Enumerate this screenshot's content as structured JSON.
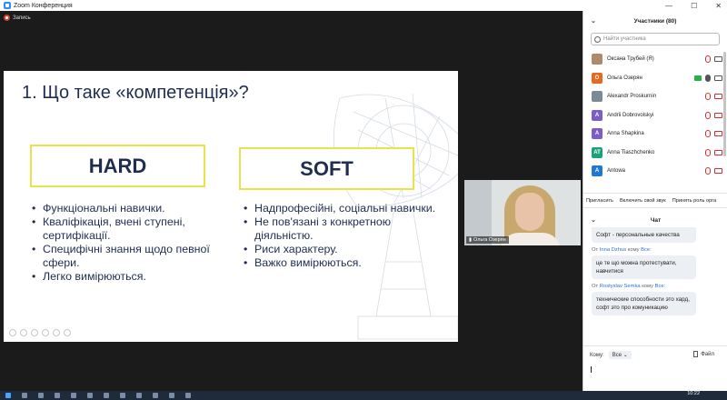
{
  "window": {
    "title": "Zoom Конференция",
    "minimize": "—",
    "maximize": "☐",
    "close": "✕"
  },
  "recording": {
    "label": "Запись"
  },
  "slide": {
    "title": "1. Що таке «компетенція»?",
    "hard": {
      "heading": "HARD",
      "bullets": [
        "Функціональні навички.",
        "Кваліфікація, вчені ступені, сертифікації.",
        "Специфічні знання щодо певної сфери.",
        "Легко вимірюються."
      ]
    },
    "soft": {
      "heading": "SOFT",
      "bullets": [
        "Надпрофесійні, соціальні навички.",
        "Не пов'язані з конкретною діяльністю.",
        "Риси характеру.",
        "Важко вимірюються."
      ]
    }
  },
  "self_video": {
    "name": "Ольга Озерян"
  },
  "participants": {
    "title": "Участники (80)",
    "search_placeholder": "Найти участника",
    "list": [
      {
        "name": "Оксана Трубей (Я)",
        "initials": "",
        "color": "#b08a6a",
        "mic": "muted",
        "cam": "on",
        "share": false
      },
      {
        "name": "Ольга Озерян",
        "initials": "O",
        "color": "#e8681e",
        "mic": "on",
        "cam": "on",
        "share": true
      },
      {
        "name": "Alexandr Proskurnin",
        "initials": "",
        "color": "#7a8a96",
        "mic": "muted",
        "cam": "off",
        "share": false
      },
      {
        "name": "Andrii Dobrovolskyi",
        "initials": "A",
        "color": "#7b5cc8",
        "mic": "muted",
        "cam": "off",
        "share": false
      },
      {
        "name": "Anna Shapkina",
        "initials": "A",
        "color": "#7b5cc8",
        "mic": "muted",
        "cam": "off",
        "share": false
      },
      {
        "name": "Anna Tiaszhchenko",
        "initials": "AT",
        "color": "#1aa37a",
        "mic": "muted",
        "cam": "off",
        "share": false
      },
      {
        "name": "Antowa",
        "initials": "A",
        "color": "#1f78d1",
        "mic": "muted",
        "cam": "off",
        "share": false
      }
    ],
    "buttons": [
      "Пригласить",
      "Включить свой звук",
      "Принять роль орга"
    ]
  },
  "chat": {
    "title": "Чат",
    "messages": [
      {
        "from": "",
        "to": "",
        "text": "Софт - персональные качества"
      },
      {
        "from": "Inna Dzhus",
        "to": "Все:",
        "text": "це те що можна протестувати, навчитися"
      },
      {
        "from": "Rostyslav Semka",
        "to": "Все:",
        "text": "технические способности это хард, софт это про комуникацию"
      }
    ],
    "from_label": "От",
    "to_label": "кому",
    "recipient_label": "Кому:",
    "recipient_value": "Все",
    "file_label": "Файл"
  },
  "clock": {
    "time": "10:22"
  }
}
